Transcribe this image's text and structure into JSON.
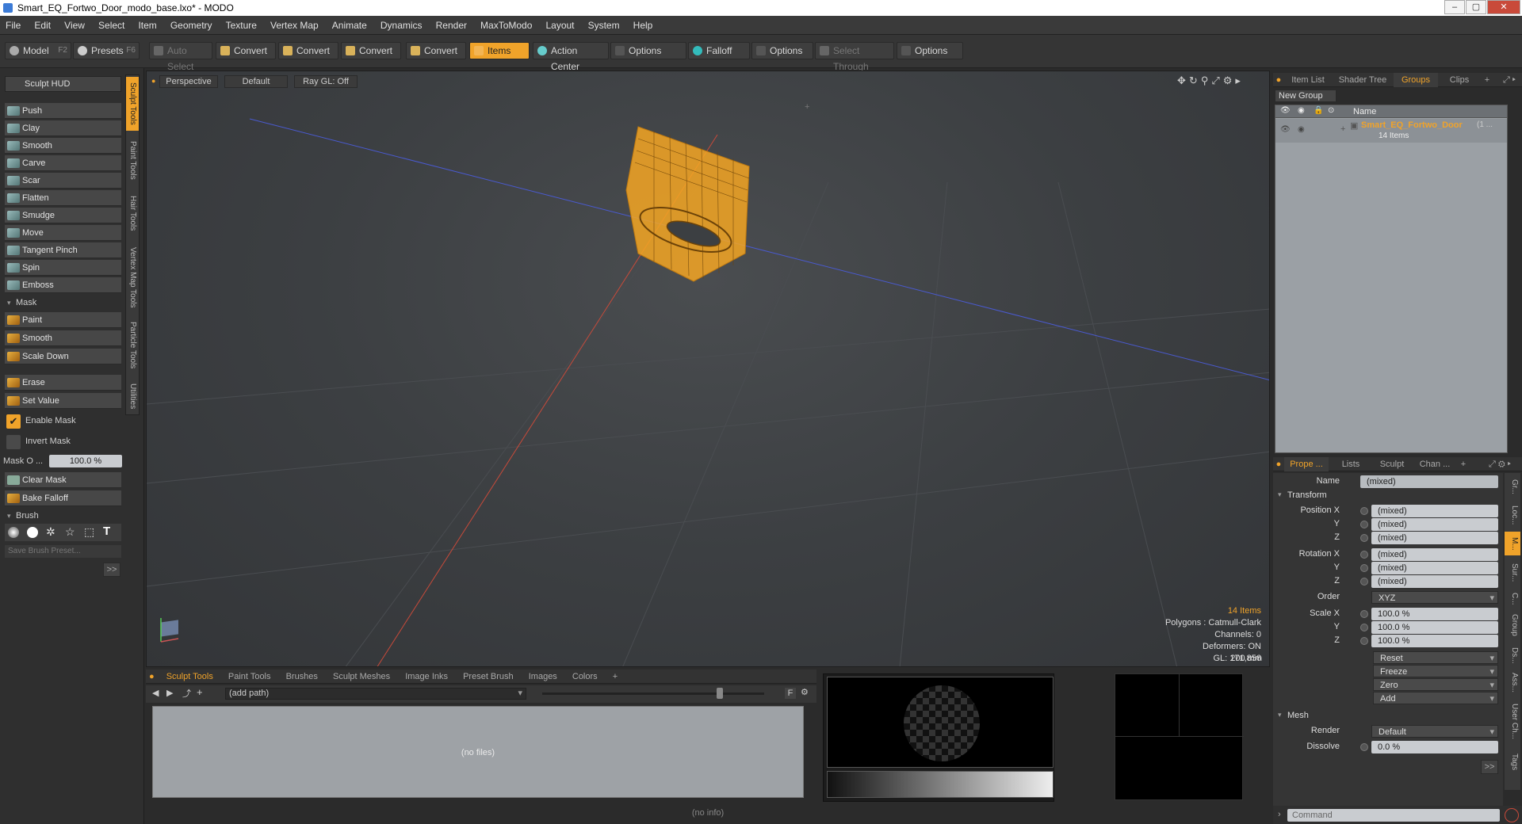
{
  "window": {
    "title": "Smart_EQ_Fortwo_Door_modo_base.lxo* - MODO",
    "min_icon": "minimize-icon",
    "max_icon": "maximize-icon",
    "close_icon": "close-icon"
  },
  "menu": [
    "File",
    "Edit",
    "View",
    "Select",
    "Item",
    "Geometry",
    "Texture",
    "Vertex Map",
    "Animate",
    "Dynamics",
    "Render",
    "MaxToModo",
    "Layout",
    "System",
    "Help"
  ],
  "toolbar": {
    "model": "Model",
    "model_key": "F2",
    "presets": "Presets",
    "presets_key": "F6",
    "auto_select": "Auto Select",
    "convert1": "Convert",
    "convert2": "Convert",
    "convert3": "Convert",
    "convert4": "Convert",
    "items": "Items",
    "action_center": "Action Center",
    "options1": "Options",
    "falloff": "Falloff",
    "options2": "Options",
    "select_through": "Select Through",
    "options3": "Options"
  },
  "left": {
    "hud": "Sculpt HUD",
    "tools": [
      "Push",
      "Clay",
      "Smooth",
      "Carve",
      "Scar",
      "Flatten",
      "Smudge",
      "Move",
      "Tangent Pinch",
      "Spin",
      "Emboss"
    ],
    "mask_section": "Mask",
    "mask_tools": [
      "Paint",
      "Smooth",
      "Scale Down"
    ],
    "erase": "Erase",
    "set_value": "Set Value",
    "enable_mask": "Enable Mask",
    "invert_mask": "Invert Mask",
    "mask_opacity_label": "Mask O ...",
    "mask_opacity_value": "100.0 %",
    "clear_mask": "Clear Mask",
    "bake_falloff": "Bake Falloff",
    "brush_section": "Brush",
    "save_brush": "Save Brush Preset...",
    "more": ">>",
    "vtabs": [
      "Sculpt Tools",
      "Paint Tools",
      "Hair Tools",
      "Vertex Map Tools",
      "Particle Tools",
      "Utilities"
    ]
  },
  "viewport": {
    "perspective": "Perspective",
    "default": "Default",
    "raygl": "Ray GL: Off",
    "items_count": "14 Items",
    "polygons": "Polygons : Catmull-Clark",
    "channels": "Channels: 0",
    "deformers": "Deformers: ON",
    "gl": "GL: 171,856",
    "scale": "200 mm"
  },
  "bottom": {
    "tabs": [
      "Sculpt Tools",
      "Paint Tools",
      "Brushes",
      "Sculpt Meshes",
      "Image Inks",
      "Preset Brush",
      "Images",
      "Colors",
      "+"
    ],
    "path": "(add path)",
    "no_files": "(no files)",
    "f_button": "F",
    "status": "(no info)"
  },
  "right": {
    "tabs": [
      "Item List",
      "Shader Tree",
      "Groups",
      "Clips",
      "+"
    ],
    "new_group": "New Group",
    "name_col": "Name",
    "group_name": "Smart_EQ_Fortwo_Door",
    "group_sub": "(1 ...",
    "group_count": "14 Items",
    "prop_tabs": [
      "Prope ...",
      "Lists",
      "Sculpt",
      "Chan ...",
      "+"
    ],
    "name_label": "Name",
    "name_value": "(mixed)",
    "transform": "Transform",
    "position_x": "Position X",
    "y": "Y",
    "z": "Z",
    "rotation_x": "Rotation X",
    "scale_x": "Scale X",
    "mixed": "(mixed)",
    "order_label": "Order",
    "order_value": "XYZ",
    "scale_val": "100.0 %",
    "reset": "Reset",
    "freeze": "Freeze",
    "zero": "Zero",
    "add": "Add",
    "mesh": "Mesh",
    "render_label": "Render",
    "render_value": "Default",
    "dissolve_label": "Dissolve",
    "dissolve_value": "0.0 %",
    "more": ">>",
    "command": "Command",
    "rvtabs": [
      "Gr...",
      "Loc...",
      "M...",
      "Sur...",
      "C...",
      "Group",
      "Ds...",
      "Ass...",
      "User Ch...",
      "Tags"
    ]
  },
  "colors": {
    "accent": "#f0a32a",
    "mesh": "#f5a623",
    "x_axis": "#c84a3a",
    "z_axis": "#4a5ad0"
  }
}
